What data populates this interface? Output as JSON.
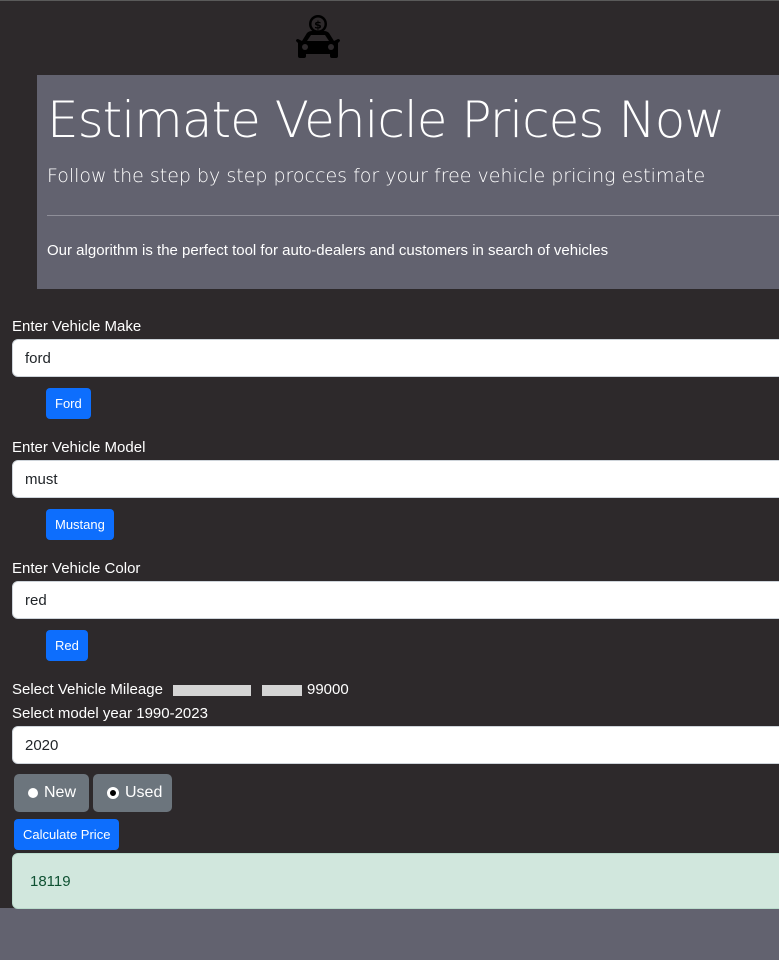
{
  "hero": {
    "title": "Estimate Vehicle Prices Now",
    "subtitle": "Follow the step by step procces for your free vehicle pricing estimate",
    "description": "Our algorithm is the perfect tool for auto-dealers and customers in search of vehicles"
  },
  "make": {
    "label": "Enter Vehicle Make",
    "value": "ford",
    "suggestion": "Ford"
  },
  "model": {
    "label": "Enter Vehicle Model",
    "value": "must",
    "suggestion": "Mustang"
  },
  "color": {
    "label": "Enter Vehicle Color",
    "value": "red",
    "suggestion": "Red"
  },
  "mileage": {
    "label": "Select Vehicle Mileage",
    "value": "99000"
  },
  "year": {
    "label": "Select model year 1990-2023",
    "value": "2020"
  },
  "condition": {
    "options": [
      "New",
      "Used"
    ],
    "selected": "Used"
  },
  "calculate_label": "Calculate Price",
  "result": "18119",
  "colors": {
    "page_bg": "#2d292b",
    "hero_bg": "#62626f",
    "primary": "#0d6efd",
    "secondary": "#6c757d",
    "result_bg": "#d1e7dd",
    "result_text": "#0f5132"
  },
  "icons": {
    "logo": "car-price-icon"
  }
}
